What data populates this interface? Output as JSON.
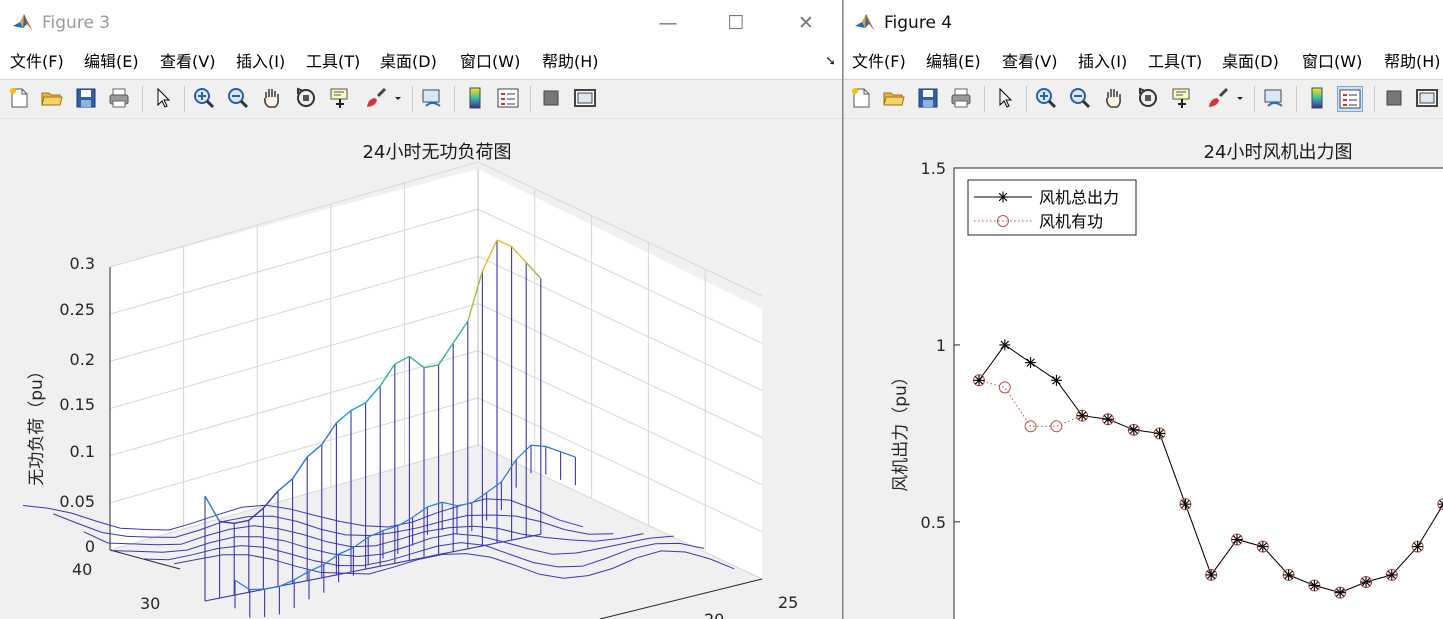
{
  "figure3": {
    "title": "Figure 3",
    "menu": [
      "文件(F)",
      "编辑(E)",
      "查看(V)",
      "插入(I)",
      "工具(T)",
      "桌面(D)",
      "窗口(W)",
      "帮助(H)"
    ],
    "window_controls": {
      "minimize": "—",
      "maximize": "☐",
      "close": "✕"
    },
    "plot": {
      "title": "24小时无功负荷图",
      "zlabel": "无功负荷（pu）",
      "z_ticks": [
        "0",
        "0.05",
        "0.1",
        "0.15",
        "0.2",
        "0.25",
        "0.3"
      ],
      "y_ticks": [
        "40",
        "30"
      ],
      "x_ticks": [
        "25",
        "20"
      ]
    }
  },
  "figure4": {
    "title": "Figure 4",
    "menu": [
      "文件(F)",
      "编辑(E)",
      "查看(V)",
      "插入(I)",
      "工具(T)",
      "桌面(D)",
      "窗口(W)",
      "帮助(H)"
    ]
  },
  "toolbar_icons": [
    "new-figure-icon",
    "open-file-icon",
    "save-icon",
    "print-icon",
    "pointer-icon",
    "zoom-in-icon",
    "zoom-out-icon",
    "pan-hand-icon",
    "rotate-3d-icon",
    "data-cursor-icon",
    "brush-icon",
    "link-plot-icon",
    "colorbar-icon",
    "legend-icon",
    "hide-plot-tools-icon",
    "show-plot-tools-icon"
  ],
  "chart_data": [
    {
      "type": "surface",
      "title": "24小时无功负荷图",
      "zlabel": "无功负荷（pu）",
      "zlim": [
        0,
        0.3
      ],
      "z_ticks": [
        0,
        0.05,
        0.1,
        0.15,
        0.2,
        0.25,
        0.3
      ],
      "x_ticks_visible": [
        25,
        20
      ],
      "y_ticks_visible": [
        40,
        30
      ],
      "front_profile": {
        "x": [
          1,
          2,
          3,
          4,
          5,
          6,
          7,
          8,
          9,
          10,
          11,
          12,
          13,
          14,
          15,
          16,
          17,
          18,
          19,
          20,
          21,
          22,
          23,
          24
        ],
        "values": [
          0.09,
          0.06,
          0.055,
          0.055,
          0.065,
          0.08,
          0.09,
          0.11,
          0.12,
          0.14,
          0.15,
          0.155,
          0.17,
          0.19,
          0.195,
          0.18,
          0.18,
          0.2,
          0.22,
          0.27,
          0.3,
          0.29,
          0.27,
          0.25
        ]
      },
      "colormap": "parula",
      "grid": true
    },
    {
      "type": "line",
      "title": "24小时风机出力图",
      "ylabel": "风机出力（pu）",
      "ylim": [
        0.2,
        1.5
      ],
      "y_ticks": [
        0.5,
        1,
        1.5
      ],
      "legend_position": "top-left",
      "series": [
        {
          "name": "风机总出力",
          "color": "#000000",
          "marker": "asterisk",
          "line": "solid",
          "x": [
            1,
            2,
            3,
            4,
            5,
            6,
            7,
            8,
            9,
            10,
            11,
            12,
            13,
            14,
            15,
            16,
            17,
            18,
            19
          ],
          "values": [
            0.9,
            1.0,
            0.95,
            0.9,
            0.8,
            0.79,
            0.76,
            0.75,
            0.55,
            0.35,
            0.45,
            0.43,
            0.35,
            0.32,
            0.3,
            0.33,
            0.35,
            0.43,
            0.55
          ]
        },
        {
          "name": "风机有功",
          "color": "#c0504d",
          "marker": "circle",
          "line": "dotted",
          "x": [
            1,
            2,
            3,
            4,
            5,
            6,
            7,
            8,
            9,
            10,
            11,
            12,
            13,
            14,
            15,
            16,
            17,
            18,
            19
          ],
          "values": [
            0.9,
            0.88,
            0.77,
            0.77,
            0.8,
            0.79,
            0.76,
            0.75,
            0.55,
            0.35,
            0.45,
            0.43,
            0.35,
            0.32,
            0.3,
            0.33,
            0.35,
            0.43,
            0.55
          ]
        }
      ]
    }
  ]
}
